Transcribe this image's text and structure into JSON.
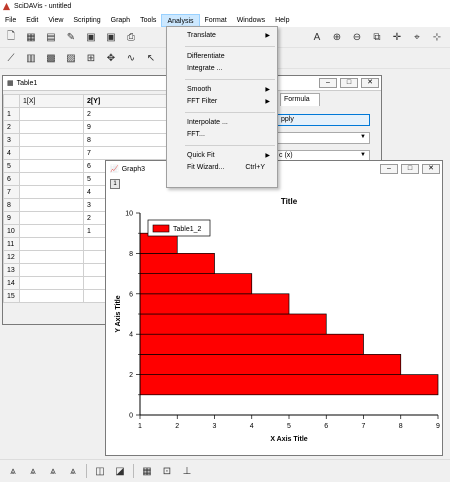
{
  "app": {
    "title": "SciDAVis - untitled"
  },
  "menubar": [
    "File",
    "Edit",
    "View",
    "Scripting",
    "Graph",
    "Tools",
    "Analysis",
    "Format",
    "Windows",
    "Help"
  ],
  "table_window": {
    "title": "Table1",
    "col_x": "1[X]",
    "col_y": "2[Y]",
    "row_numbers": [
      "1",
      "2",
      "3",
      "4",
      "5",
      "6",
      "7",
      "8",
      "9",
      "10",
      "11",
      "12",
      "13",
      "14",
      "15"
    ],
    "y_values": [
      "2",
      "9",
      "8",
      "7",
      "6",
      "5",
      "4",
      "3",
      "2",
      "1",
      "",
      "",
      "",
      "",
      ""
    ],
    "formula_tab": "Formula",
    "apply_label": "pply",
    "combo2_value": "c (x)"
  },
  "analysis_menu": {
    "items": [
      {
        "label": "Translate",
        "arrow": "▶",
        "shortcut": ""
      },
      {
        "label": "Differentiate",
        "arrow": "",
        "shortcut": ""
      },
      {
        "label": "Integrate ...",
        "arrow": "",
        "shortcut": ""
      },
      {
        "label": "Smooth",
        "arrow": "▶",
        "shortcut": ""
      },
      {
        "label": "FFT Filter",
        "arrow": "▶",
        "shortcut": ""
      },
      {
        "label": "Interpolate ...",
        "arrow": "",
        "shortcut": ""
      },
      {
        "label": "FFT...",
        "arrow": "",
        "shortcut": ""
      },
      {
        "label": "Quick Fit",
        "arrow": "▶",
        "shortcut": ""
      },
      {
        "label": "Fit Wizard...",
        "arrow": "",
        "shortcut": "Ctrl+Y"
      }
    ]
  },
  "graph_window": {
    "title": "Graph3",
    "layer": "1"
  },
  "chart_data": {
    "type": "bar",
    "orientation": "horizontal",
    "title": "Title",
    "xlabel": "X Axis Title",
    "ylabel": "Y Axis Title",
    "xlim": [
      1,
      9
    ],
    "ylim": [
      0,
      10
    ],
    "x_ticks": [
      "1",
      "2",
      "3",
      "4",
      "5",
      "6",
      "7",
      "8",
      "9"
    ],
    "y_ticks": [
      "0",
      "2",
      "4",
      "6",
      "8",
      "10"
    ],
    "legend": "Table1_2",
    "legend_position": "top-left",
    "bar_color": "#ff0000",
    "bars": [
      {
        "y": 1,
        "x": 9
      },
      {
        "y": 2,
        "x": 8
      },
      {
        "y": 3,
        "x": 7
      },
      {
        "y": 4,
        "x": 6
      },
      {
        "y": 5,
        "x": 5
      },
      {
        "y": 6,
        "x": 4
      },
      {
        "y": 7,
        "x": 3
      },
      {
        "y": 8,
        "x": 2
      }
    ]
  }
}
